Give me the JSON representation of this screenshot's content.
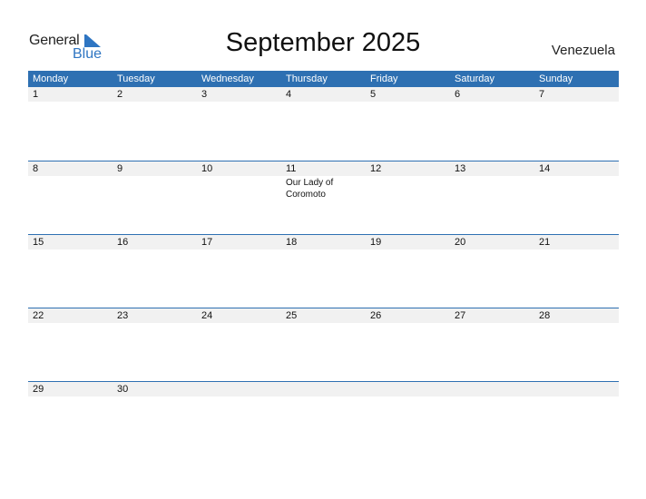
{
  "logo": {
    "word1": "General",
    "word2": "Blue"
  },
  "title": "September 2025",
  "country": "Venezuela",
  "colors": {
    "header_bg": "#2E70B2",
    "logo_blue": "#2E75C2",
    "day_strip_bg": "#F1F1F1"
  },
  "weekdays": [
    "Monday",
    "Tuesday",
    "Wednesday",
    "Thursday",
    "Friday",
    "Saturday",
    "Sunday"
  ],
  "weeks": [
    {
      "days": [
        "1",
        "2",
        "3",
        "4",
        "5",
        "6",
        "7"
      ],
      "events": [
        "",
        "",
        "",
        "",
        "",
        "",
        ""
      ]
    },
    {
      "days": [
        "8",
        "9",
        "10",
        "11",
        "12",
        "13",
        "14"
      ],
      "events": [
        "",
        "",
        "",
        "Our Lady of Coromoto",
        "",
        "",
        ""
      ]
    },
    {
      "days": [
        "15",
        "16",
        "17",
        "18",
        "19",
        "20",
        "21"
      ],
      "events": [
        "",
        "",
        "",
        "",
        "",
        "",
        ""
      ]
    },
    {
      "days": [
        "22",
        "23",
        "24",
        "25",
        "26",
        "27",
        "28"
      ],
      "events": [
        "",
        "",
        "",
        "",
        "",
        "",
        ""
      ]
    },
    {
      "days": [
        "29",
        "30",
        "",
        "",
        "",
        "",
        ""
      ],
      "events": [
        "",
        "",
        "",
        "",
        "",
        "",
        ""
      ]
    }
  ]
}
